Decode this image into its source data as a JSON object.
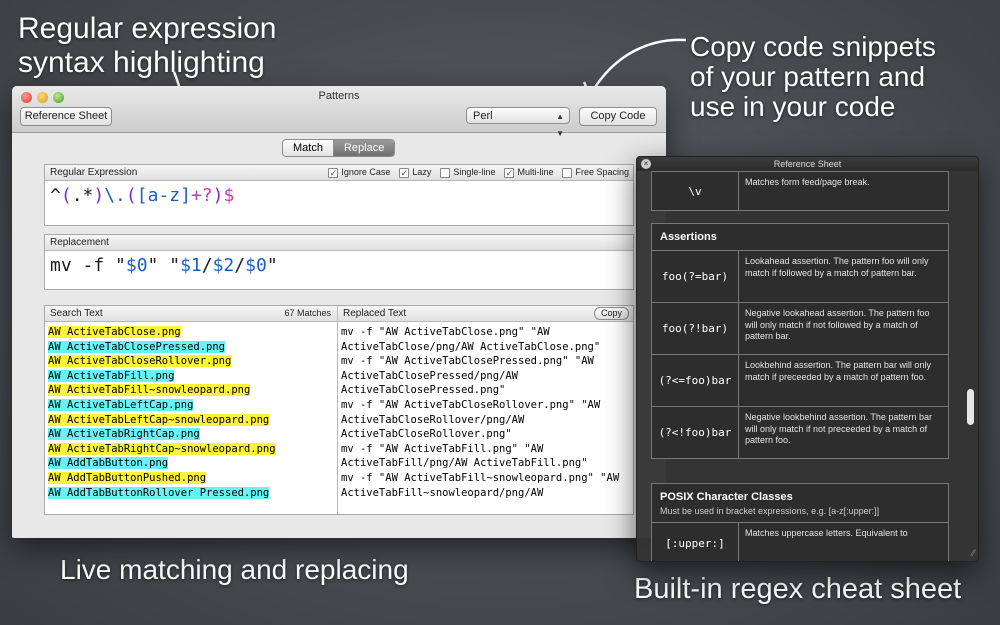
{
  "captions": {
    "top_left_1": "Regular expression",
    "top_left_2": "syntax highlighting",
    "top_right_1": "Copy code snippets",
    "top_right_2": "of your pattern and",
    "top_right_3": "use in your code",
    "bottom_left": "Live matching and replacing",
    "bottom_right": "Built-in regex cheat sheet"
  },
  "window": {
    "title": "Patterns",
    "reference_button": "Reference Sheet",
    "language": "Perl",
    "copy_code_button": "Copy Code",
    "segments": {
      "match": "Match",
      "replace": "Replace",
      "selected": "Replace"
    }
  },
  "regex_panel": {
    "label": "Regular Expression",
    "options": [
      {
        "label": "Ignore Case",
        "checked": true
      },
      {
        "label": "Lazy",
        "checked": true
      },
      {
        "label": "Single-line",
        "checked": false
      },
      {
        "label": "Multi-line",
        "checked": true
      },
      {
        "label": "Free Spacing",
        "checked": false
      }
    ],
    "pattern_parts": [
      "^",
      "(",
      ".*",
      ")",
      "\\.",
      "(",
      "[a-z]",
      "+?",
      ")",
      "$"
    ]
  },
  "replacement_panel": {
    "label": "Replacement",
    "parts": [
      "mv -f \"",
      "$0",
      "\" \"",
      "$1",
      "/",
      "$2",
      "/",
      "$0",
      "\""
    ]
  },
  "search_panel": {
    "label": "Search Text",
    "match_count": "67 Matches",
    "lines": [
      {
        "text": "AW ActiveTabClose.png",
        "color": "yellow"
      },
      {
        "text": "AW ActiveTabClosePressed.png",
        "color": "cyan"
      },
      {
        "text": "AW ActiveTabCloseRollover.png",
        "color": "yellow"
      },
      {
        "text": "AW ActiveTabFill.png",
        "color": "cyan"
      },
      {
        "text": "AW ActiveTabFill~snowleopard.png",
        "color": "yellow"
      },
      {
        "text": "AW ActiveTabLeftCap.png",
        "color": "cyan"
      },
      {
        "text": "AW ActiveTabLeftCap~snowleopard.png",
        "color": "yellow"
      },
      {
        "text": "AW ActiveTabRightCap.png",
        "color": "cyan"
      },
      {
        "text": "AW ActiveTabRightCap~snowleopard.png",
        "color": "yellow"
      },
      {
        "text": "AW AddTabButton.png",
        "color": "cyan"
      },
      {
        "text": "AW AddTabButtonPushed.png",
        "color": "yellow"
      },
      {
        "text": "AW AddTabButtonRollover Pressed.png",
        "color": "cyan"
      }
    ]
  },
  "replaced_panel": {
    "label": "Replaced Text",
    "copy_button": "Copy",
    "lines": [
      "mv -f \"AW ActiveTabClose.png\" \"AW",
      "ActiveTabClose/png/AW ActiveTabClose.png\"",
      "mv -f \"AW ActiveTabClosePressed.png\" \"AW",
      "ActiveTabClosePressed/png/AW",
      "ActiveTabClosePressed.png\"",
      "mv -f \"AW ActiveTabCloseRollover.png\" \"AW",
      "ActiveTabCloseRollover/png/AW",
      "ActiveTabCloseRollover.png\"",
      "mv -f \"AW ActiveTabFill.png\" \"AW",
      "ActiveTabFill/png/AW ActiveTabFill.png\"",
      "mv -f \"AW ActiveTabFill~snowleopard.png\" \"AW",
      "ActiveTabFill~snowleopard/png/AW"
    ]
  },
  "reference_sheet": {
    "title": "Reference Sheet",
    "top_row": {
      "key": "\\v",
      "desc": "Matches form feed/page break."
    },
    "assertions_title": "Assertions",
    "assertions": [
      {
        "key": "foo(?=bar)",
        "desc": "Lookahead assertion. The pattern foo will only match if followed by a match of pattern bar."
      },
      {
        "key": "foo(?!bar)",
        "desc": "Negative lookahead assertion. The pattern foo will only match if not followed by a match of pattern bar."
      },
      {
        "key": "(?<=foo)bar",
        "desc": "Lookbehind assertion. The pattern bar will only match if preceeded by a match of pattern foo."
      },
      {
        "key": "(?<!foo)bar",
        "desc": "Negative lookbehind assertion. The pattern bar will only match if not preceeded by a match of pattern foo."
      }
    ],
    "posix_title": "POSIX Character Classes",
    "posix_subtitle": "Must be used in bracket expressions, e.g. [a-z[:upper:]]",
    "posix_row": {
      "key": "[:upper:]",
      "desc": "Matches uppercase letters. Equivalent to"
    }
  }
}
